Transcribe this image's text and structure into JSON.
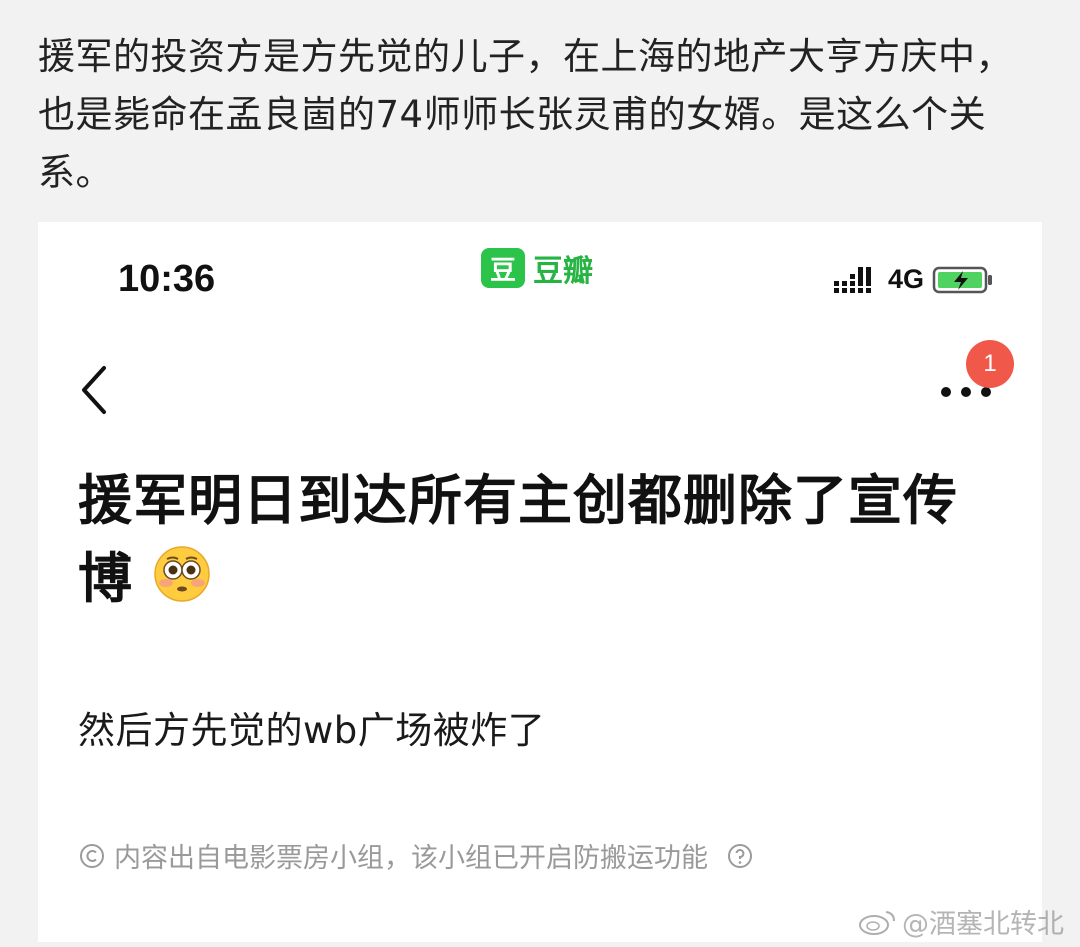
{
  "caption": "援军的投资方是方先觉的儿子，在上海的地产大亨方庆中，也是毙命在孟良崮的74师师长张灵甫的女婿。是这么个关系。",
  "status_bar": {
    "time": "10:36",
    "app_logo_char": "豆",
    "app_name": "豆瓣",
    "network": "4G",
    "signal_icon": "signal-icon",
    "battery_icon": "battery-charging-icon"
  },
  "nav": {
    "back_icon": "chevron-left-icon",
    "more_icon": "more-dots-icon",
    "badge_count": "1"
  },
  "post": {
    "title": "援军明日到达所有主创都删除了宣传博",
    "title_emoji": "flushed-face-emoji",
    "body": "然后方先觉的wb广场被炸了",
    "footer_note": "内容出自电影票房小组，该小组已开启防搬运功能"
  },
  "watermark": "@酒塞北转北",
  "colors": {
    "douban_green": "#2cc34a",
    "badge_red": "#f0594a",
    "note_gray": "#9a9a9a"
  }
}
